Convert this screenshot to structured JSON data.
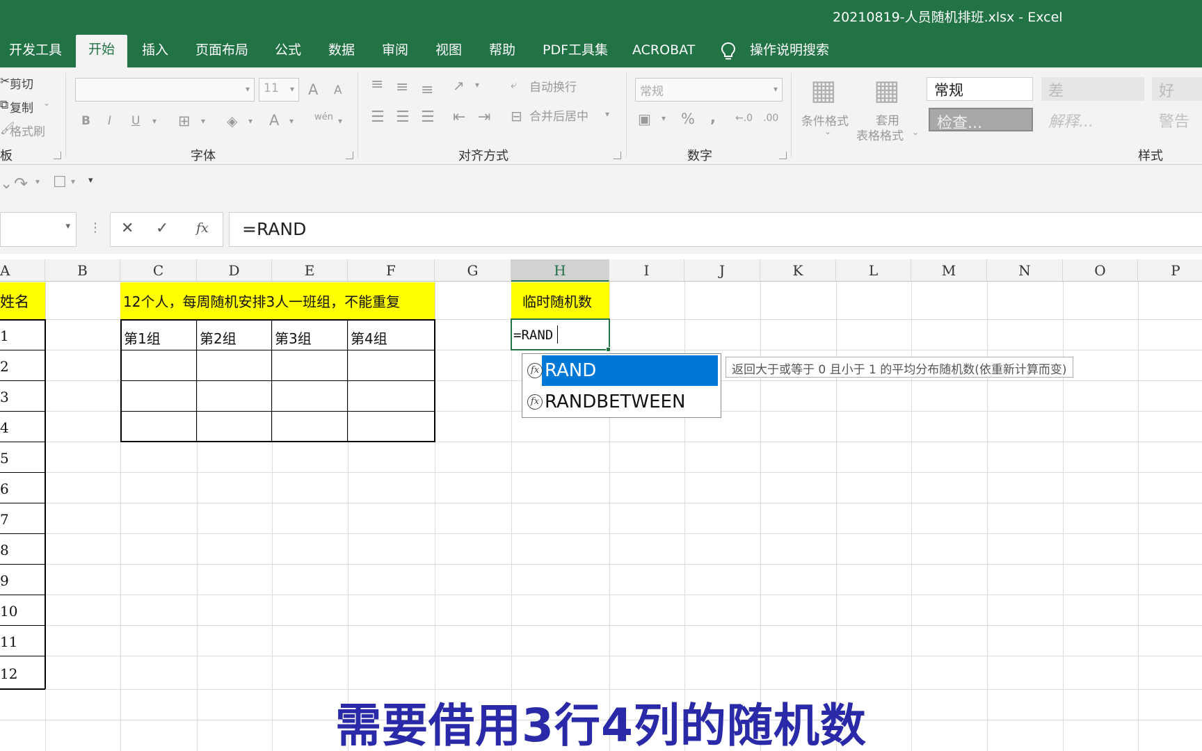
{
  "window": {
    "title": "20210819-人员随机排班.xlsx  -  Excel"
  },
  "ribbon_tabs": [
    "开发工具",
    "开始",
    "插入",
    "页面布局",
    "公式",
    "数据",
    "审阅",
    "视图",
    "帮助",
    "PDF工具集",
    "ACROBAT"
  ],
  "search_label": "操作说明搜索",
  "clipboard": {
    "cut": "剪切",
    "copy": "复制",
    "format_painter": "格式刷",
    "label": "板"
  },
  "font": {
    "size": "11",
    "label": "字体",
    "bold": "B",
    "italic": "I",
    "underline": "U",
    "grow": "A",
    "shrink": "A",
    "color": "A",
    "phonetic": "wén"
  },
  "alignment": {
    "wrap": "自动换行",
    "merge": "合并后居中",
    "label": "对齐方式"
  },
  "number": {
    "format": "常规",
    "percent": "%",
    "comma": ",",
    "label": "数字"
  },
  "styles": {
    "conditional": "条件格式",
    "table_line1": "套用",
    "table_line2": "表格格式",
    "normal": "常规",
    "bad": "差",
    "good": "好",
    "check": "检查...",
    "explanatory": "解释...",
    "warning": "警告",
    "label": "样式"
  },
  "formula_bar": {
    "cancel": "✕",
    "enter": "✓",
    "fx": "fx",
    "value": "=RAND"
  },
  "columns": [
    "A",
    "B",
    "C",
    "D",
    "E",
    "F",
    "G",
    "H",
    "I",
    "J",
    "K",
    "L",
    "M",
    "N",
    "O",
    "P"
  ],
  "sheet": {
    "a_header": "姓名",
    "a_values": [
      "1",
      "2",
      "3",
      "4",
      "5",
      "6",
      "7",
      "8",
      "9",
      "10",
      "11",
      "12"
    ],
    "banner": "12个人，每周随机安排3人一班组，不能重复",
    "groups": [
      "第1组",
      "第2组",
      "第3组",
      "第4组"
    ],
    "h_header": "临时随机数",
    "h_editing": "=RAND"
  },
  "autocomplete": {
    "items": [
      "RAND",
      "RANDBETWEEN"
    ],
    "tooltip": "返回大于或等于 0 且小于 1 的平均分布随机数(依重新计算而变)"
  },
  "subtitle": "需要借用3行4列的随机数"
}
